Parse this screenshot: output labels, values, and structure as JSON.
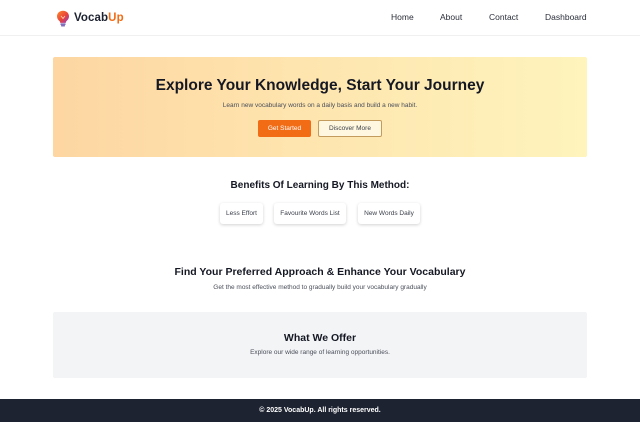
{
  "brand": {
    "name_part1": "Vocab",
    "name_part2": "Up",
    "accent": "#f26b15"
  },
  "nav": {
    "home": "Home",
    "about": "About",
    "contact": "Contact",
    "dashboard": "Dashboard"
  },
  "hero": {
    "title": "Explore Your Knowledge, Start Your Journey",
    "subtitle": "Learn new vocabulary words on a daily basis and build a new habit.",
    "primary_button": "Get Started",
    "secondary_button": "Discover More"
  },
  "benefits": {
    "title": "Benefits Of Learning By This Method:",
    "items": [
      "Less Effort",
      "Favourite Words List",
      "New Words Daily"
    ]
  },
  "approach": {
    "title": "Find Your Preferred Approach & Enhance Your Vocabulary",
    "subtitle": "Get the most effective method to gradually build your vocabulary gradually"
  },
  "offer": {
    "title": "What We Offer",
    "subtitle": "Explore our wide range of learning opportunities."
  },
  "footer": {
    "text": "© 2025 VocabUp. All rights reserved."
  },
  "icons": {
    "logo": "lightbulb-icon"
  }
}
